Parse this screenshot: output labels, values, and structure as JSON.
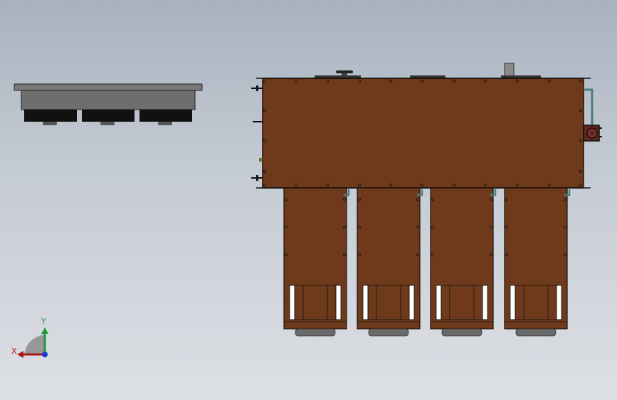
{
  "viewport": {
    "background_top": "#a8b2bf",
    "background_bottom": "#dde0e5"
  },
  "colors": {
    "tank_brown": "#6f3a1c",
    "tank_outline": "#2a1a10",
    "side_view_gray": "#6e6e6e",
    "side_view_black": "#111111",
    "pipe_teal": "#4d7a80",
    "axis_x": "#b01818",
    "axis_y": "#1a9a3a",
    "axis_z": "#1a3ad0"
  },
  "triad": {
    "x_label": "X",
    "y_label": "Y"
  },
  "model": {
    "side_view_legs": 3,
    "top_view_hoppers": 4
  }
}
